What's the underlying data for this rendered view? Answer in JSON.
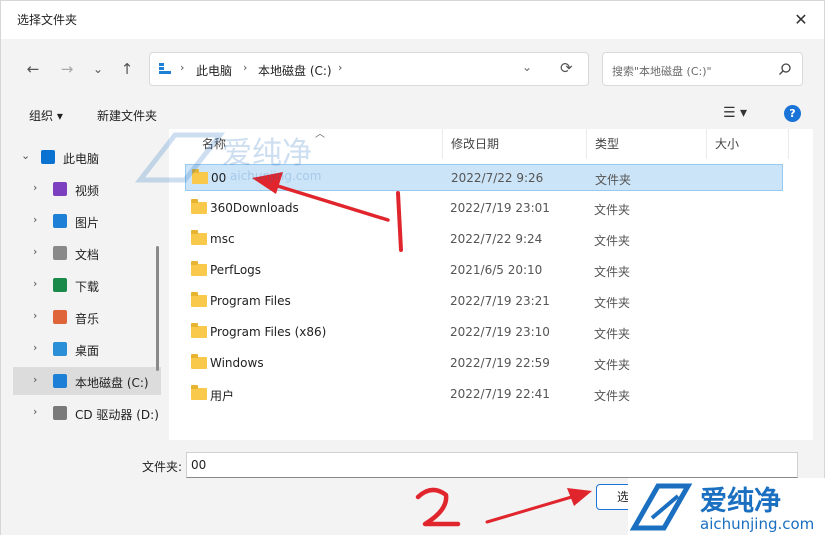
{
  "window": {
    "title": "选择文件夹",
    "close_symbol": "✕"
  },
  "nav": {
    "back": "←",
    "forward": "→",
    "recent": "⌄",
    "up": "↑",
    "crumbs": [
      "此电脑",
      "本地磁盘 (C:)"
    ],
    "refresh": "⟳",
    "search_placeholder": "搜索\"本地磁盘 (C:)\""
  },
  "toolbar": {
    "organize": "组织 ▾",
    "new_folder": "新建文件夹",
    "view": "☰ ▾",
    "help": "?"
  },
  "sidebar": [
    {
      "label": "此电脑",
      "icon": "monitor-icon",
      "color": "#0a72d1"
    },
    {
      "label": "视频",
      "icon": "video-icon",
      "color": "#7b3fbf"
    },
    {
      "label": "图片",
      "icon": "picture-icon",
      "color": "#1e7fd6"
    },
    {
      "label": "文档",
      "icon": "document-icon",
      "color": "#8a8a8a"
    },
    {
      "label": "下载",
      "icon": "download-icon",
      "color": "#1a8a4a"
    },
    {
      "label": "音乐",
      "icon": "music-icon",
      "color": "#e0643a"
    },
    {
      "label": "桌面",
      "icon": "desktop-icon",
      "color": "#2b8fd8"
    },
    {
      "label": "本地磁盘 (C:)",
      "icon": "drive-icon",
      "color": "#1e7fd6"
    },
    {
      "label": "CD 驱动器 (D:)",
      "icon": "cd-drive-icon",
      "color": "#7a7a7a"
    }
  ],
  "columns": {
    "name": "名称",
    "date": "修改日期",
    "type": "类型",
    "size": "大小"
  },
  "files": [
    {
      "name": "00",
      "date": "2022/7/22 9:26",
      "type": "文件夹"
    },
    {
      "name": "360Downloads",
      "date": "2022/7/19 23:01",
      "type": "文件夹"
    },
    {
      "name": "msc",
      "date": "2022/7/22 9:24",
      "type": "文件夹"
    },
    {
      "name": "PerfLogs",
      "date": "2021/6/5 20:10",
      "type": "文件夹"
    },
    {
      "name": "Program Files",
      "date": "2022/7/19 23:21",
      "type": "文件夹"
    },
    {
      "name": "Program Files (x86)",
      "date": "2022/7/19 23:10",
      "type": "文件夹"
    },
    {
      "name": "Windows",
      "date": "2022/7/19 22:59",
      "type": "文件夹"
    },
    {
      "name": "用户",
      "date": "2022/7/19 22:41",
      "type": "文件夹"
    }
  ],
  "footer": {
    "folder_label": "文件夹:",
    "folder_value": "00",
    "select_button": "选"
  },
  "watermark": {
    "brand": "爱纯净",
    "url": "aichunjing.com",
    "color": "#1a6fc0"
  },
  "annotations": {
    "arrow_color": "#e0252d",
    "mark1": "1",
    "mark2": "2"
  }
}
